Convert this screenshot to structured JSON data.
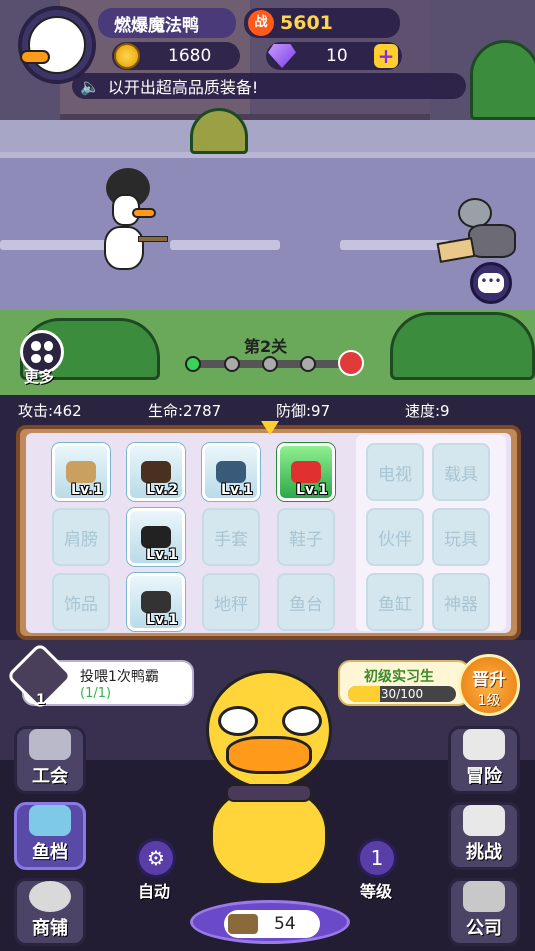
{
  "player": {
    "name": "燃爆魔法鸭",
    "power_icon": "战",
    "power": "5601"
  },
  "currency": {
    "coins": "1680",
    "gems": "10"
  },
  "notice": {
    "text": "以开出超高品质装备!"
  },
  "stage": {
    "label": "第2关",
    "more_label": "更多"
  },
  "stats": {
    "attack": "攻击:462",
    "hp": "生命:2787",
    "defense": "防御:97",
    "speed": "速度:9"
  },
  "equipment": [
    {
      "label": "",
      "level": "Lv.1",
      "icon": "rifle-icon"
    },
    {
      "label": "",
      "level": "Lv.2",
      "icon": "wig-icon"
    },
    {
      "label": "",
      "level": "Lv.1",
      "icon": "armor-icon"
    },
    {
      "label": "",
      "level": "Lv.1",
      "icon": "necklace-icon"
    },
    {
      "label": "肩膀",
      "level": ""
    },
    {
      "label": "",
      "level": "Lv.1",
      "icon": "belt-icon"
    },
    {
      "label": "手套",
      "level": ""
    },
    {
      "label": "鞋子",
      "level": ""
    },
    {
      "label": "饰品",
      "level": ""
    },
    {
      "label": "",
      "level": "Lv.1",
      "icon": "mask-icon"
    },
    {
      "label": "地秤",
      "level": ""
    },
    {
      "label": "鱼台",
      "level": ""
    }
  ],
  "locked_slots": [
    "电视",
    "载具",
    "伙伴",
    "玩具",
    "鱼缸",
    "神器"
  ],
  "quest": {
    "text": "投喂1次鸭霸",
    "progress": "(1/1)",
    "count": "1"
  },
  "rank": {
    "title": "初级实习生",
    "progress_text": "30/100",
    "progress": 0.3,
    "promote_label": "晋升",
    "promote_level": "1级"
  },
  "left_buttons": [
    "工会",
    "鱼档",
    "商铺"
  ],
  "right_buttons": [
    "冒险",
    "挑战",
    "公司"
  ],
  "auto": {
    "label": "自动"
  },
  "level": {
    "value": "1",
    "label": "等级"
  },
  "fish": {
    "count": "54"
  },
  "colors": {
    "accent": "#ffcf30",
    "panel": "#c08a5a",
    "purple": "#5a3ea8"
  }
}
